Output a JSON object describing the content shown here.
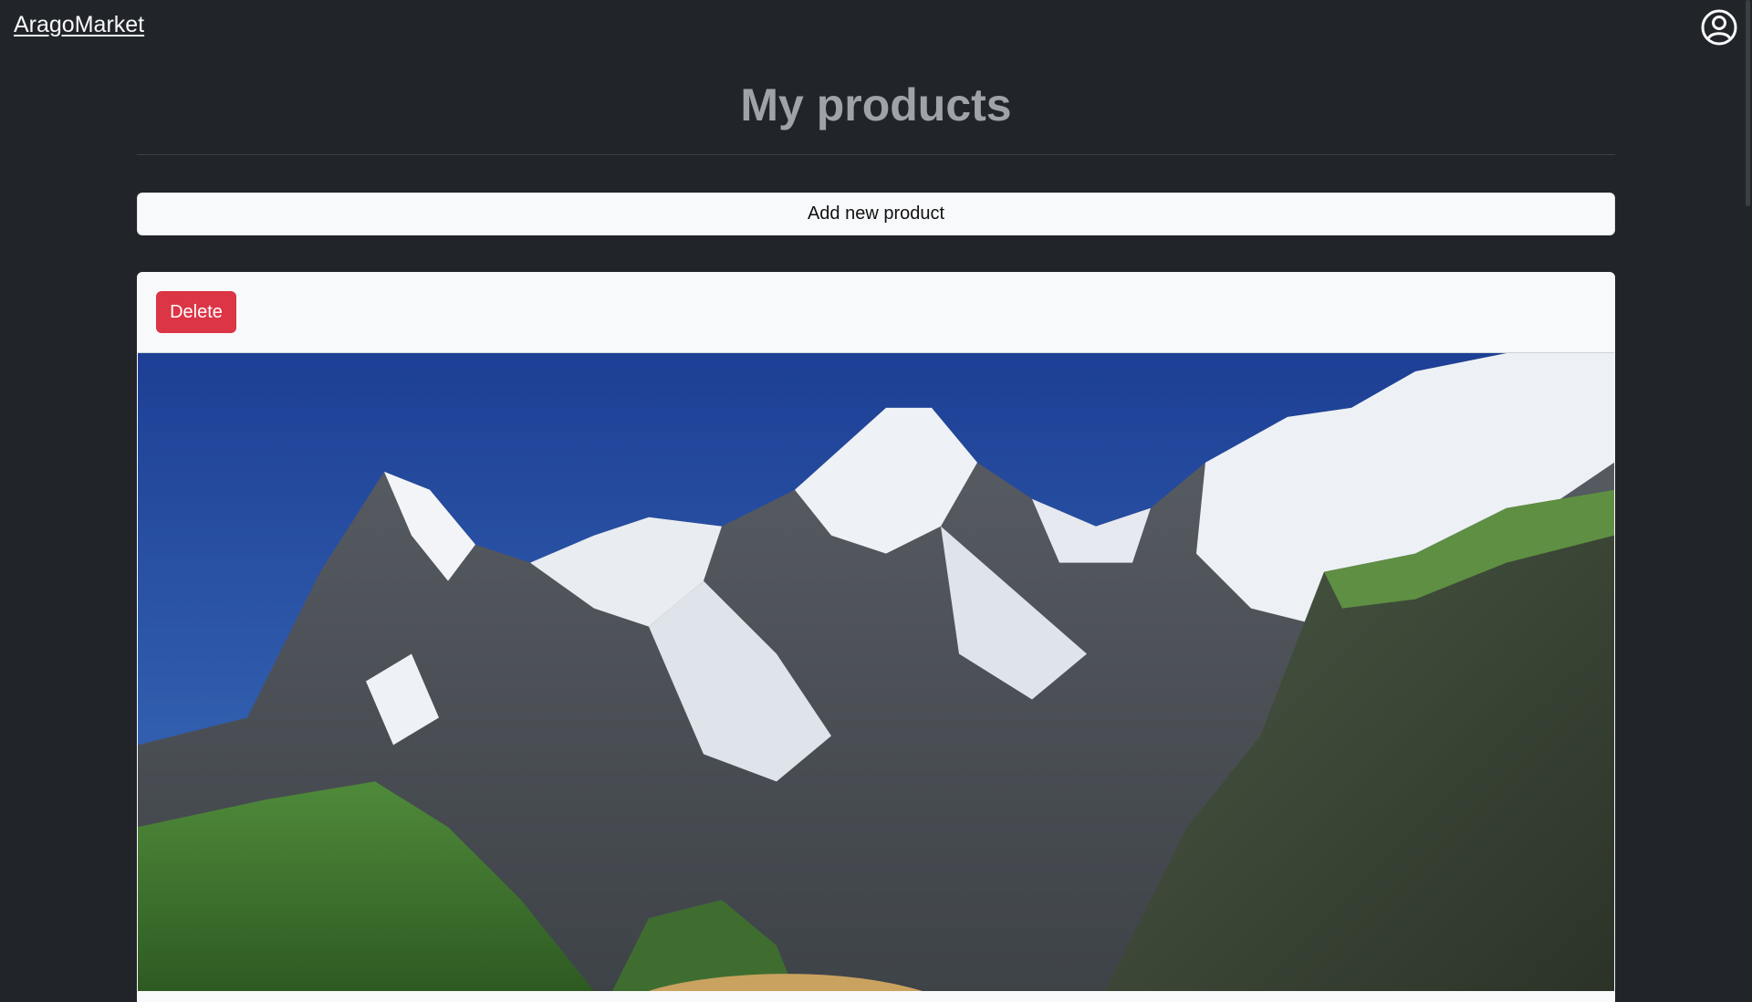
{
  "navbar": {
    "brand": "AragoMarket",
    "profile_icon": "person-circle-icon"
  },
  "page": {
    "title": "My products"
  },
  "actions": {
    "add_label": "Add new product"
  },
  "product_card": {
    "delete_label": "Delete",
    "image_icon": "mountain-landscape-image"
  },
  "colors": {
    "background": "#212529",
    "delete": "#dc3545",
    "card": "#f8f9fa"
  }
}
